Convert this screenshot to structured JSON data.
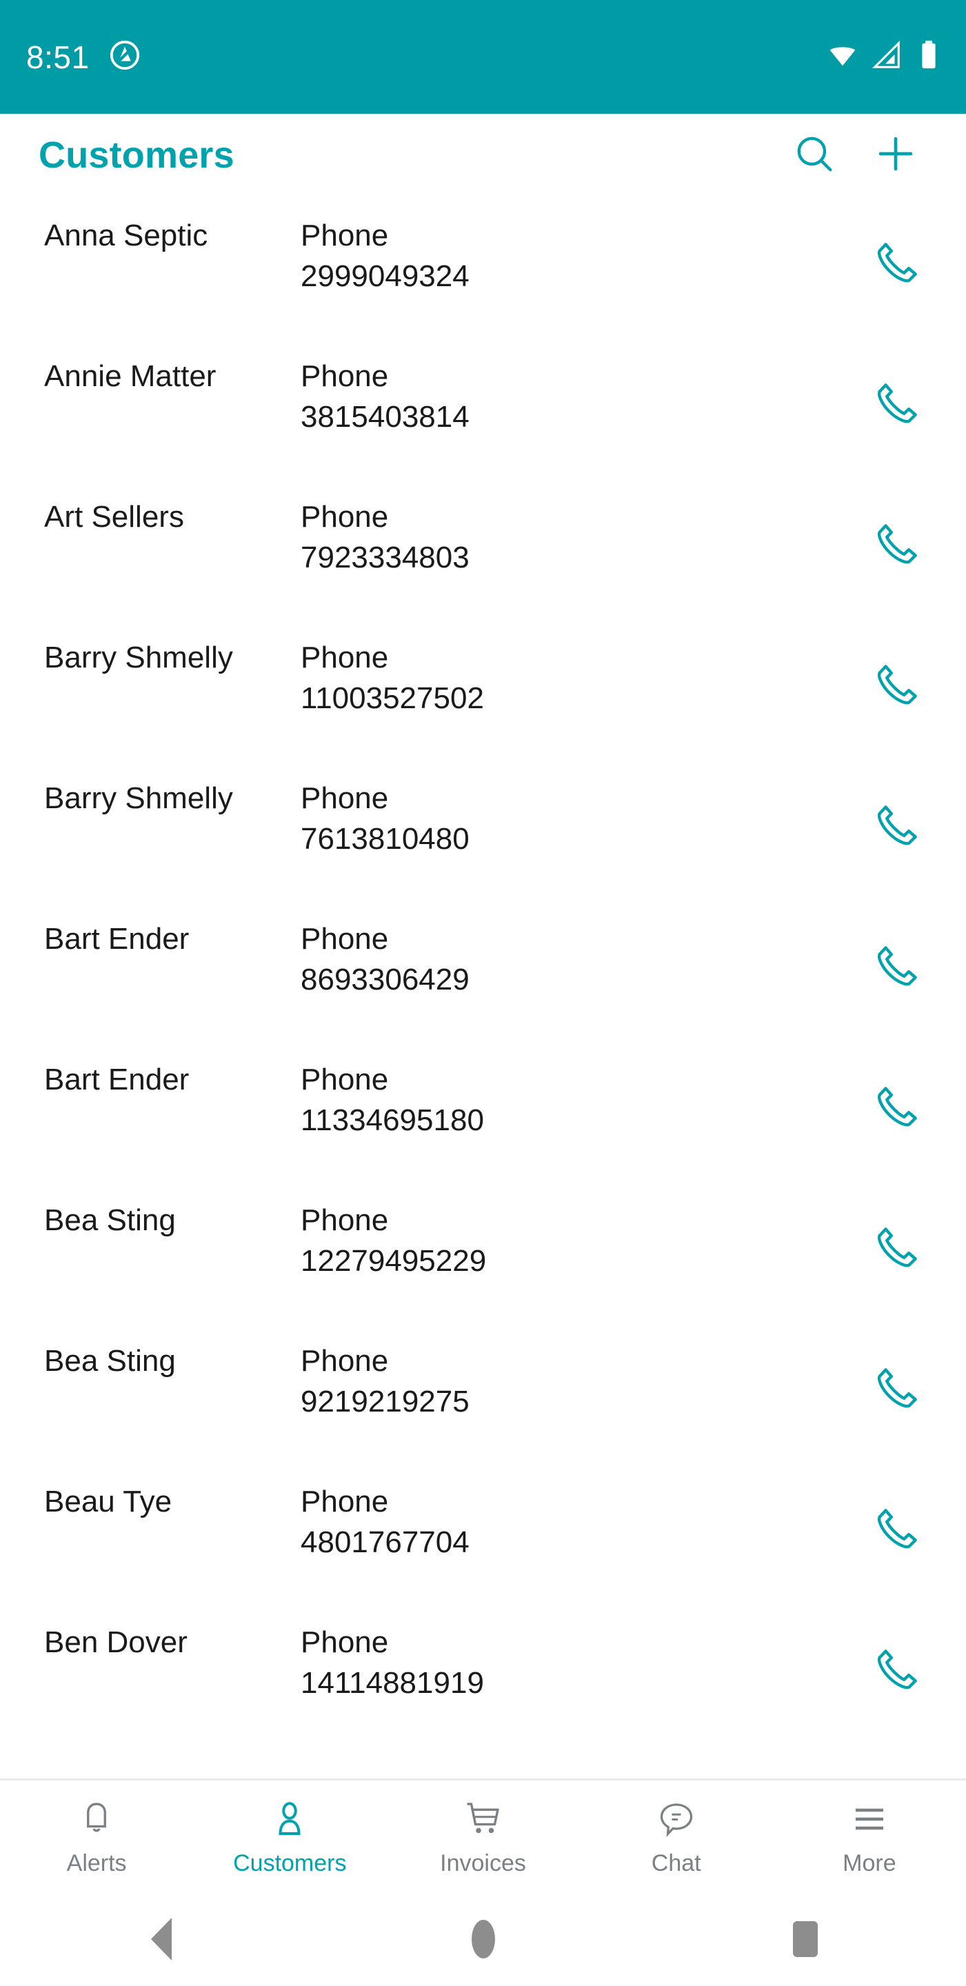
{
  "status_bar": {
    "time": "8:51",
    "notification_icon": "app-notification-icon",
    "wifi_icon": "wifi-icon",
    "signal_icon": "cellular-signal-icon",
    "battery_icon": "battery-full-icon",
    "background_color": "#009CA6",
    "foreground_color": "#FFFFFF"
  },
  "app_bar": {
    "title": "Customers",
    "title_color": "#00A3AD",
    "search_icon": "search-icon",
    "add_icon": "plus-icon"
  },
  "list": {
    "phone_label": "Phone",
    "call_icon": "phone-call-icon",
    "accent_color": "#00A3AD",
    "rows": [
      {
        "name": "Anna Septic",
        "phone_label": "Phone",
        "phone": "2999049324"
      },
      {
        "name": "Annie Matter",
        "phone_label": "Phone",
        "phone": "3815403814"
      },
      {
        "name": "Art Sellers",
        "phone_label": "Phone",
        "phone": "7923334803"
      },
      {
        "name": "Barry Shmelly",
        "phone_label": "Phone",
        "phone": "11003527502"
      },
      {
        "name": "Barry Shmelly",
        "phone_label": "Phone",
        "phone": "7613810480"
      },
      {
        "name": "Bart Ender",
        "phone_label": "Phone",
        "phone": "8693306429"
      },
      {
        "name": "Bart Ender",
        "phone_label": "Phone",
        "phone": "11334695180"
      },
      {
        "name": "Bea Sting",
        "phone_label": "Phone",
        "phone": "12279495229"
      },
      {
        "name": "Bea Sting",
        "phone_label": "Phone",
        "phone": "9219219275"
      },
      {
        "name": "Beau Tye",
        "phone_label": "Phone",
        "phone": "4801767704"
      },
      {
        "name": "Ben Dover",
        "phone_label": "Phone",
        "phone": "14114881919"
      }
    ]
  },
  "tab_bar": {
    "active_index": 1,
    "active_color": "#00A3AD",
    "inactive_color": "#7B8084",
    "tabs": [
      {
        "label": "Alerts",
        "icon": "bell-icon"
      },
      {
        "label": "Customers",
        "icon": "person-icon"
      },
      {
        "label": "Invoices",
        "icon": "shopping-cart-icon"
      },
      {
        "label": "Chat",
        "icon": "chat-bubble-icon"
      },
      {
        "label": "More",
        "icon": "hamburger-menu-icon"
      }
    ]
  },
  "nav_bar": {
    "back": "back-triangle-icon",
    "home": "home-circle-icon",
    "recents": "recents-square-icon"
  }
}
